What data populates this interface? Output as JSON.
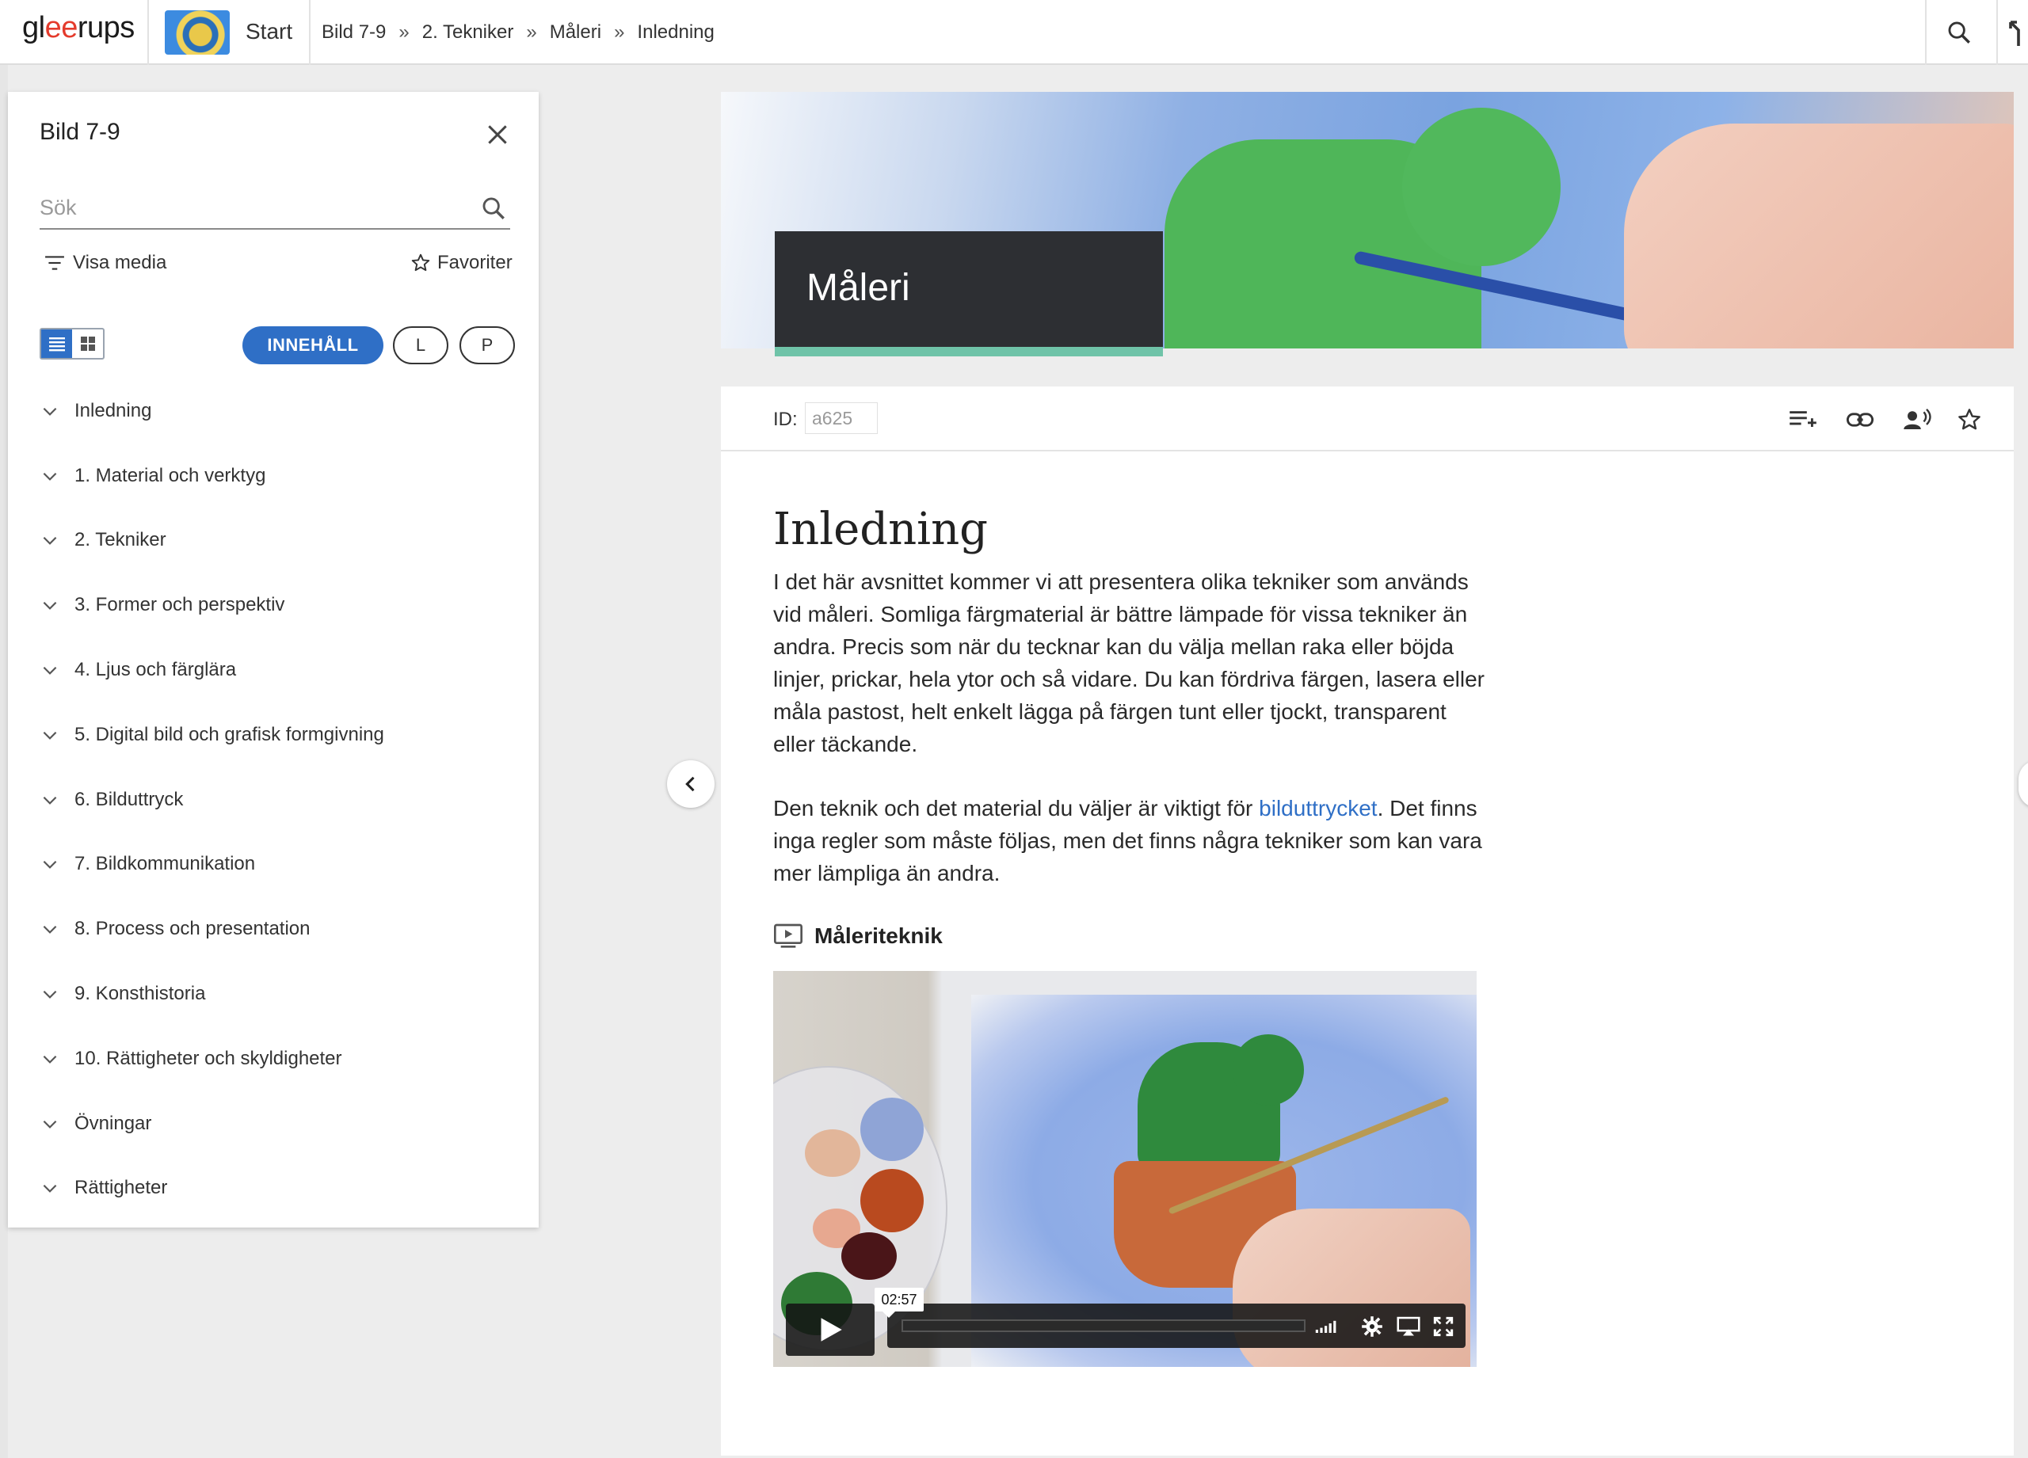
{
  "topbar": {
    "logo_prefix": "gl",
    "logo_accent": "ee",
    "logo_suffix": "rups",
    "start_label": "Start",
    "breadcrumbs": [
      "Bild 7-9",
      "2. Tekniker",
      "Måleri",
      "Inledning"
    ],
    "breadcrumb_separator": "»",
    "search_icon": "search-icon"
  },
  "sidebar": {
    "title": "Bild 7-9",
    "search_placeholder": "Sök",
    "filter_label": "Visa media",
    "favorites_label": "Favoriter",
    "content_pill": "INNEHÅLL",
    "pill_l": "L",
    "pill_p": "P",
    "toc": [
      "Inledning",
      "1. Material och verktyg",
      "2. Tekniker",
      "3. Former och perspektiv",
      "4. Ljus och färglära",
      "5. Digital bild och grafisk formgivning",
      "6. Bilduttryck",
      "7. Bildkommunikation",
      "8. Process och presentation",
      "9. Konsthistoria",
      "10. Rättigheter och skyldigheter",
      "Övningar",
      "Rättigheter"
    ]
  },
  "hero": {
    "title": "Måleri",
    "accent_color": "#6fc3a8"
  },
  "article": {
    "id_label": "ID:",
    "id_value": "a625",
    "heading": "Inledning",
    "paragraph1": "I det här avsnittet kommer vi att presentera olika tekniker som används vid måleri. Somliga färgmaterial är bättre lämpade för vissa tekniker än andra. Precis som när du tecknar kan du välja mellan raka eller böjda linjer, prickar, hela ytor och så vidare. Du kan fördriva färgen, lasera eller måla pastost, helt enkelt lägga på färgen tunt eller tjockt, transparent eller täckande.",
    "paragraph2_before": "Den teknik och det material du väljer är viktigt för ",
    "paragraph2_link": "bilduttrycket",
    "paragraph2_after": ". Det finns inga regler som måste följas, men det finns några tekniker som kan vara mer lämpliga än andra.",
    "media_title": "Måleriteknik",
    "video_time": "02:57"
  },
  "colors": {
    "primary": "#2f6fc6",
    "link": "#2f6fc6",
    "logo_accent": "#e43b2c"
  }
}
